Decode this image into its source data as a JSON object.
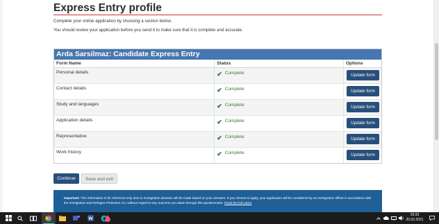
{
  "page": {
    "title": "Express Entry profile",
    "intro_line1": "Complete your online application by choosing a section below.",
    "intro_line2": "You should review your application before you send it to make sure that it is complete and accurate."
  },
  "panel": {
    "heading": "Arda Sarsilmaz: Candidate Express Entry",
    "columns": [
      "Form Name",
      "Status",
      "Options"
    ],
    "rows": [
      {
        "name": "Personal details",
        "status": "Complete",
        "action": "Update form"
      },
      {
        "name": "Contact details",
        "status": "Complete",
        "action": "Update form"
      },
      {
        "name": "Study and languages",
        "status": "Complete",
        "action": "Update form"
      },
      {
        "name": "Application details",
        "status": "Complete",
        "action": "Update form"
      },
      {
        "name": "Representative",
        "status": "Complete",
        "action": "Update form"
      },
      {
        "name": "Work history",
        "status": "Complete",
        "action": "Update form"
      }
    ]
  },
  "actions": {
    "continue": "Continue",
    "save_exit": "Save and exit"
  },
  "notice": {
    "important": "Important:",
    "text": " This information is for reference only and no immigration decision will be made based on your answers. If you choose to apply, your application will be considered by an immigration officer in accordance with the Immigration and Refugee Protection Act, without regard to any outcome you attain through this questionnaire. ",
    "link": "Read the full notice"
  },
  "taskbar": {
    "time": "23:33",
    "date": "20.02.2021",
    "icons": [
      "windows-icon",
      "search-icon",
      "task-view-icon",
      "chrome-icon",
      "file-explorer-icon",
      "teams-icon",
      "word-icon",
      "edge-icon",
      "app-icon"
    ],
    "tray_icons": [
      "chevron-up-icon",
      "cloud-icon",
      "network-icon",
      "volume-icon",
      "notification-icon"
    ]
  },
  "colors": {
    "panel_header": "#4776b0",
    "primary_button": "#284e7a",
    "title_rule": "#c9313b",
    "complete_green": "#2e7d32",
    "notice_bg": "#1f5f97"
  }
}
